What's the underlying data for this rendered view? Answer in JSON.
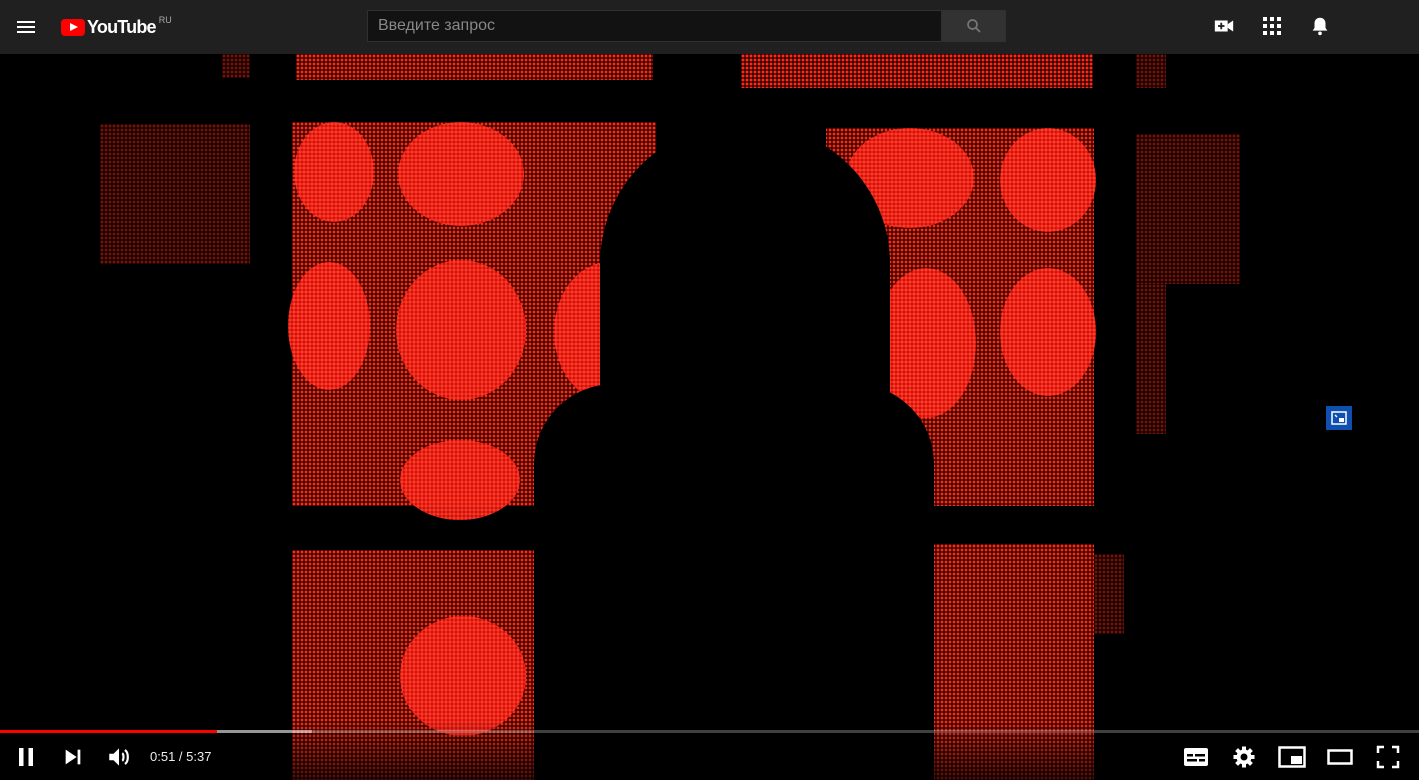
{
  "header": {
    "logo_text": "YouTube",
    "region": "RU",
    "search": {
      "placeholder": "Введите запрос"
    }
  },
  "icons": {
    "menu": "menu-icon",
    "search": "search-icon",
    "create": "create-video-icon",
    "apps": "apps-grid-icon",
    "notifications": "bell-icon",
    "pip_side": "picture-in-picture-icon"
  },
  "player": {
    "current_time": "0:51",
    "duration": "5:37",
    "time_display": "0:51 / 5:37",
    "progress_played_fraction": 0.153,
    "progress_buffered_fraction": 0.22,
    "accent_color": "#ff0000"
  },
  "controls": {
    "play_pause": "pause-icon",
    "next": "next-icon",
    "volume": "volume-icon",
    "subtitles": "subtitles-icon",
    "settings": "gear-icon",
    "miniplayer": "miniplayer-icon",
    "theater": "theater-mode-icon",
    "fullscreen": "fullscreen-icon"
  }
}
